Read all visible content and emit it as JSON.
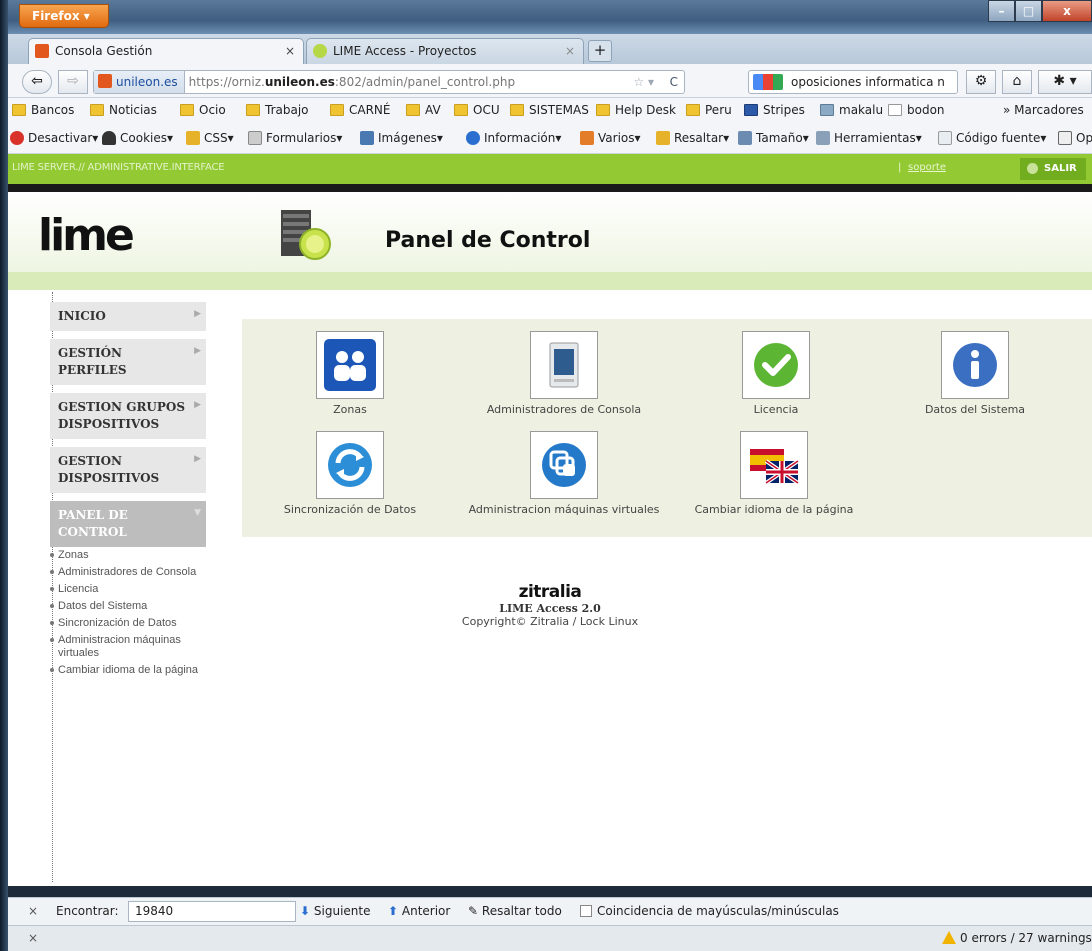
{
  "browser": {
    "menu_button": "Firefox ▾",
    "tabs": [
      {
        "label": "Consola Gestión",
        "close": "×"
      },
      {
        "label": "LIME Access - Proyectos",
        "close": "×"
      }
    ],
    "new_tab": "+",
    "url": {
      "site_identity": "unileon.es",
      "prefix": "https://orniz.",
      "domain": "unileon.es",
      "suffix": ":802/admin/panel_control.php"
    },
    "search": "oposiciones informatica n",
    "bookmarks": [
      "Bancos",
      "Noticias",
      "Ocio",
      "Trabajo",
      "CARNÉ",
      "AV",
      "OCU",
      "SISTEMAS",
      "Help Desk",
      "Peru",
      "Stripes",
      "makalu",
      "bodon"
    ],
    "bookmarks_more": "» Marcadores",
    "devtools": [
      "Desactivar▾",
      "Cookies▾",
      "CSS▾",
      "Formularios▾",
      "Imágenes▾",
      "Información▾",
      "Varios▾",
      "Resaltar▾",
      "Tamaño▾",
      "Herramientas▾",
      "Código fuente▾",
      "Opc"
    ]
  },
  "app": {
    "topbar_text": "LIME SERVER.// ADMINISTRATIVE.INTERFACE",
    "topbar_sep": "|",
    "support_link": "soporte",
    "logout": "SALIR",
    "logo": "lime",
    "page_title": "Panel de Control",
    "sidebar": [
      {
        "label": "INICIO"
      },
      {
        "label": "GESTIÓN PERFILES"
      },
      {
        "label": "GESTION GRUPOS DISPOSITIVOS"
      },
      {
        "label": "GESTION DISPOSITIVOS"
      },
      {
        "label": "PANEL DE CONTROL"
      }
    ],
    "sublinks": [
      "Zonas",
      "Administradores de Consola",
      "Licencia",
      "Datos del Sistema",
      "Sincronización de Datos",
      "Administracion máquinas virtuales",
      "Cambiar idioma de la página"
    ],
    "panel_items": [
      {
        "label": "Zonas",
        "icon": "users-icon"
      },
      {
        "label": "Administradores de Consola",
        "icon": "device-icon"
      },
      {
        "label": "Licencia",
        "icon": "checkmark-icon"
      },
      {
        "label": "Datos del Sistema",
        "icon": "info-icon"
      },
      {
        "label": "Sincronización de Datos",
        "icon": "sync-icon"
      },
      {
        "label": "Administracion máquinas virtuales",
        "icon": "virtual-machine-icon"
      },
      {
        "label": "Cambiar idioma de la página",
        "icon": "flags-icon"
      }
    ],
    "footer": {
      "brand": "zitralia",
      "version": "LIME Access 2.0",
      "copyright": "Copyright© Zitralia / Lock Linux"
    }
  },
  "findbar": {
    "close": "×",
    "label": "Encontrar:",
    "value": "19840",
    "next": "Siguiente",
    "prev": "Anterior",
    "highlight": "Resaltar todo",
    "match_case": "Coincidencia de mayúsculas/minúsculas"
  },
  "statusbar": {
    "close": "×",
    "errors": "0 errors / 27 warnings"
  }
}
